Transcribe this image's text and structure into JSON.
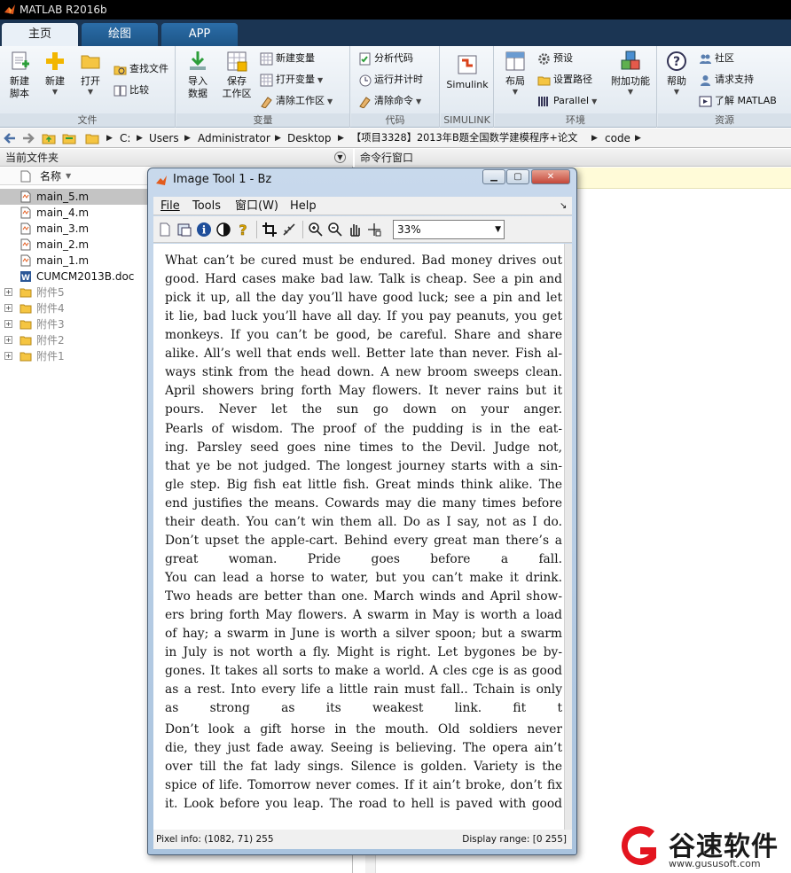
{
  "window": {
    "title": "MATLAB R2016b"
  },
  "tabs": [
    {
      "label": "主页",
      "active": true
    },
    {
      "label": "绘图",
      "active": false
    },
    {
      "label": "APP",
      "active": false
    }
  ],
  "ribbon": {
    "file": {
      "group_label": "文件",
      "new_script": "新建\n脚本",
      "new": "新建",
      "open": "打开",
      "find_files": "查找文件",
      "compare": "比较"
    },
    "variable": {
      "group_label": "变量",
      "import_data": "导入\n数据",
      "save_workspace": "保存\n工作区",
      "new_variable": "新建变量",
      "open_variable": "打开变量",
      "clear_workspace": "清除工作区"
    },
    "code": {
      "group_label": "代码",
      "analyze_code": "分析代码",
      "run_and_time": "运行并计时",
      "clear_commands": "清除命令"
    },
    "simulink": {
      "group_label": "SIMULINK",
      "simulink": "Simulink"
    },
    "environment": {
      "group_label": "环境",
      "layout": "布局",
      "preferences": "预设",
      "set_path": "设置路径",
      "parallel": "Parallel",
      "add_ons": "附加功能"
    },
    "resources": {
      "group_label": "资源",
      "help": "帮助",
      "community": "社区",
      "request_support": "请求支持",
      "learn_matlab": "了解 MATLAB"
    }
  },
  "address": {
    "crumbs": [
      "C:",
      "Users",
      "Administrator",
      "Desktop",
      "【项目3328】2013年B题全国数学建模程序+论文",
      "code"
    ]
  },
  "current_folder": {
    "header": "当前文件夹",
    "column_name": "名称",
    "files": [
      {
        "name": "main_5.m",
        "type": "m",
        "selected": true
      },
      {
        "name": "main_4.m",
        "type": "m",
        "selected": false
      },
      {
        "name": "main_3.m",
        "type": "m",
        "selected": false
      },
      {
        "name": "main_2.m",
        "type": "m",
        "selected": false
      },
      {
        "name": "main_1.m",
        "type": "m",
        "selected": false
      },
      {
        "name": "CUMCM2013B.doc",
        "type": "doc",
        "selected": false
      },
      {
        "name": "附件5",
        "type": "folder",
        "selected": false
      },
      {
        "name": "附件4",
        "type": "folder",
        "selected": false
      },
      {
        "name": "附件3",
        "type": "folder",
        "selected": false
      },
      {
        "name": "附件2",
        "type": "folder",
        "selected": false
      },
      {
        "name": "附件1",
        "type": "folder",
        "selected": false
      }
    ]
  },
  "command_window": {
    "header": "命令行窗口"
  },
  "image_tool": {
    "title": "Image Tool 1 - Bz",
    "menu": [
      "File",
      "Tools",
      "窗口(W)",
      "Help"
    ],
    "zoom": "33%",
    "toolbar_icons": [
      "new-figure-icon",
      "export-icon",
      "info-icon",
      "contrast-icon",
      "help-icon",
      "crop-icon",
      "measure-icon",
      "zoom-in-icon",
      "zoom-out-icon",
      "pan-hand-icon",
      "pixel-region-icon"
    ],
    "paragraphs": [
      "What can’t be cured must be endured. Bad money drives out\ngood. Hard cases make bad law. Talk is cheap. See a pin and\npick it up, all the day you’ll have good luck; see a pin and let\nit lie, bad luck you’ll have all day. If you pay peanuts, you get\nmonkeys. If you can’t be good, be careful. Share and share\nalike. All’s well that ends well. Better late than never. Fish al-\nways stink from the head down. A new broom sweeps clean.\nApril showers bring forth May flowers. It never rains but it\npours. Never let the sun go down on your anger.",
      "    Pearls of wisdom. The proof of the pudding is in the eat-\ning. Parsley seed goes nine times to the Devil. Judge not,\nthat ye be not judged. The longest journey starts with a sin-\ngle step. Big fish eat little fish. Great minds think alike. The\nend justifies the means. Cowards may die many times before\ntheir death. You can’t win them all. Do as I say, not as I do.\nDon’t upset the apple-cart. Behind every great man there’s a\ngreat woman. Pride goes before a fall.",
      "    You can lead a horse to water, but you can’t make it drink.\nTwo heads are better than one. March winds and April show-\ners bring forth May flowers. A swarm in May is worth a load\nof hay; a swarm in June is worth a silver spoon; but a swarm\nin July is not worth a fly. Might is right. Let bygones be by-\ngones. It takes all sorts to make a world. A cles cge is as good\nas a rest. Into every life a little rain must fall..  Tchain is only\nas strong as its weakest link.                          fit t",
      "    Don’t look a gift horse in the mouth. Old soldiers never\ndie, they just fade away. Seeing is believing. The opera ain’t\nover till the fat lady sings. Silence is golden. Variety is the\nspice of life. Tomorrow never comes. If it ain’t broke, don’t fix\nit. Look before you leap. The road to hell is paved with good"
    ],
    "status_left": "Pixel info: (1082, 71)  255",
    "status_right": "Display range: [0 255]"
  },
  "watermark": {
    "brand": "谷速软件",
    "url": "www.gususoft.com"
  },
  "colors": {
    "tabstrip": "#1b3553",
    "active_tab": "#e9f0f7",
    "selected_row": "#c4c4c4",
    "cmd_strip": "#fffbd8"
  }
}
